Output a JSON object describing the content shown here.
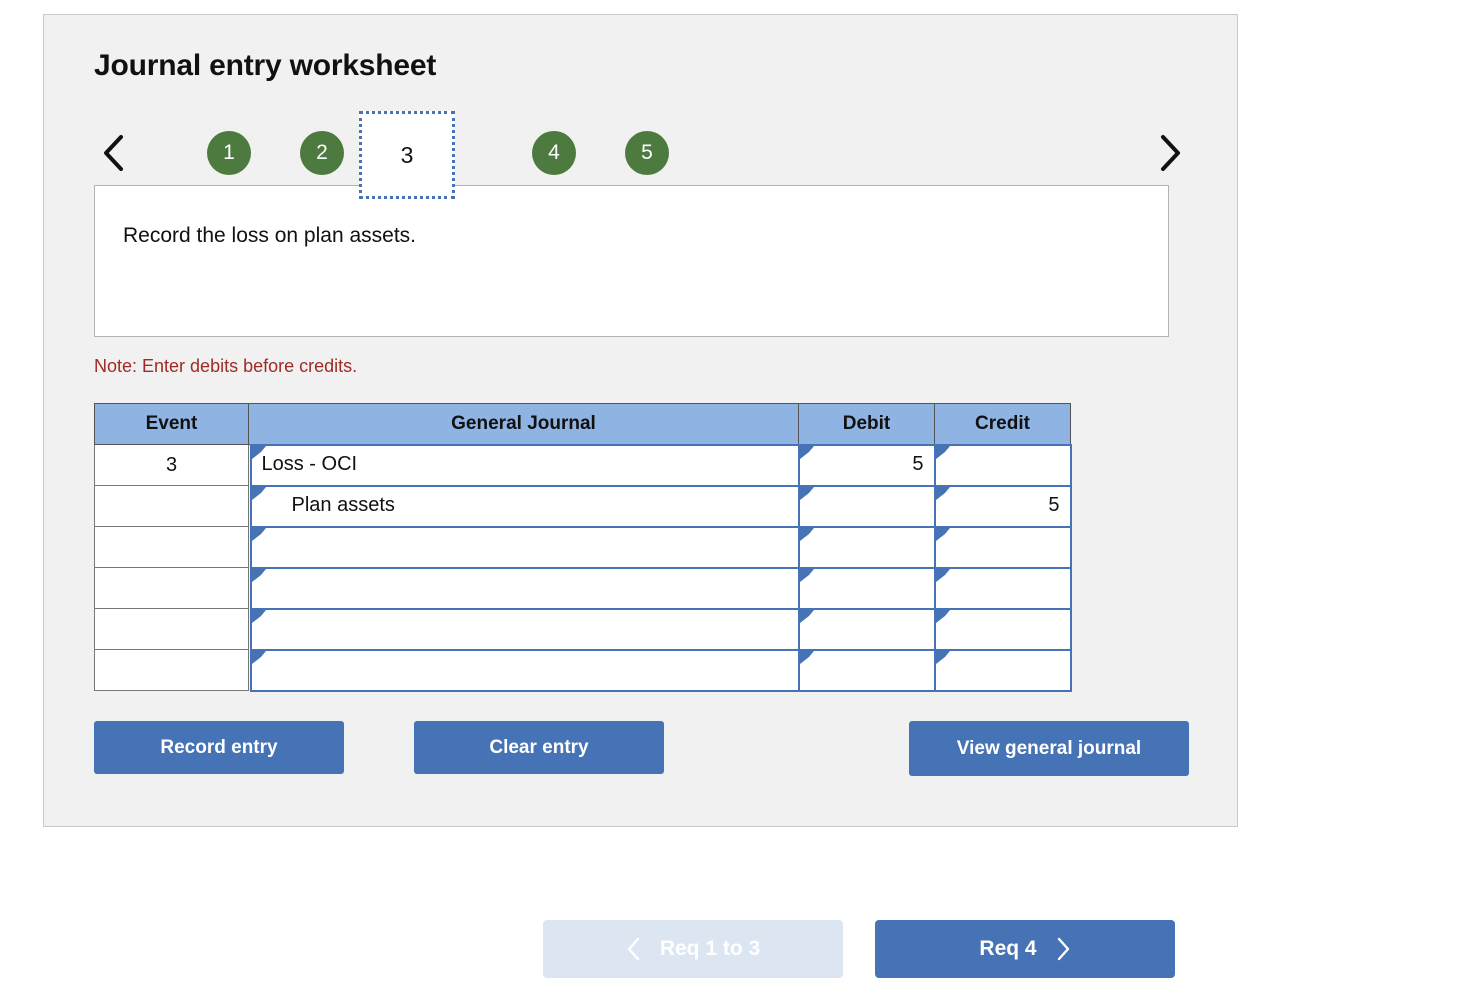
{
  "card": {
    "title": "Journal entry worksheet"
  },
  "tabs": {
    "prev_icon": "chevron-left-icon",
    "next_icon": "chevron-right-icon",
    "items": [
      {
        "label": "1",
        "active": false
      },
      {
        "label": "2",
        "active": false
      },
      {
        "label": "3",
        "active": true
      },
      {
        "label": "4",
        "active": false
      },
      {
        "label": "5",
        "active": false
      }
    ],
    "active_color": "#ffffff",
    "inactive_color": "#4d7a3e",
    "active_border_color": "#4573b5"
  },
  "prompt": {
    "text": "Record the loss on plan assets."
  },
  "note": {
    "text": "Note: Enter debits before credits.",
    "color": "#9e2b25"
  },
  "table": {
    "header_color": "#8fb4e3",
    "cell_border_color": "#4573b5",
    "columns": [
      "Event",
      "General Journal",
      "Debit",
      "Credit"
    ],
    "rows": [
      {
        "event": "3",
        "account": "Loss - OCI",
        "indent": false,
        "debit": "5",
        "credit": ""
      },
      {
        "event": "",
        "account": "Plan assets",
        "indent": true,
        "debit": "",
        "credit": "5"
      },
      {
        "event": "",
        "account": "",
        "indent": false,
        "debit": "",
        "credit": ""
      },
      {
        "event": "",
        "account": "",
        "indent": false,
        "debit": "",
        "credit": ""
      },
      {
        "event": "",
        "account": "",
        "indent": false,
        "debit": "",
        "credit": ""
      },
      {
        "event": "",
        "account": "",
        "indent": false,
        "debit": "",
        "credit": ""
      }
    ]
  },
  "actions": {
    "record_label": "Record entry",
    "clear_label": "Clear entry",
    "view_label": "View general journal",
    "button_color": "#4573b5"
  },
  "nav": {
    "prev_label": "Req 1 to 3",
    "prev_icon": "chevron-left-icon",
    "prev_color": "#dce6f2",
    "next_label": "Req 4",
    "next_icon": "chevron-right-icon",
    "next_color": "#4573b5"
  }
}
